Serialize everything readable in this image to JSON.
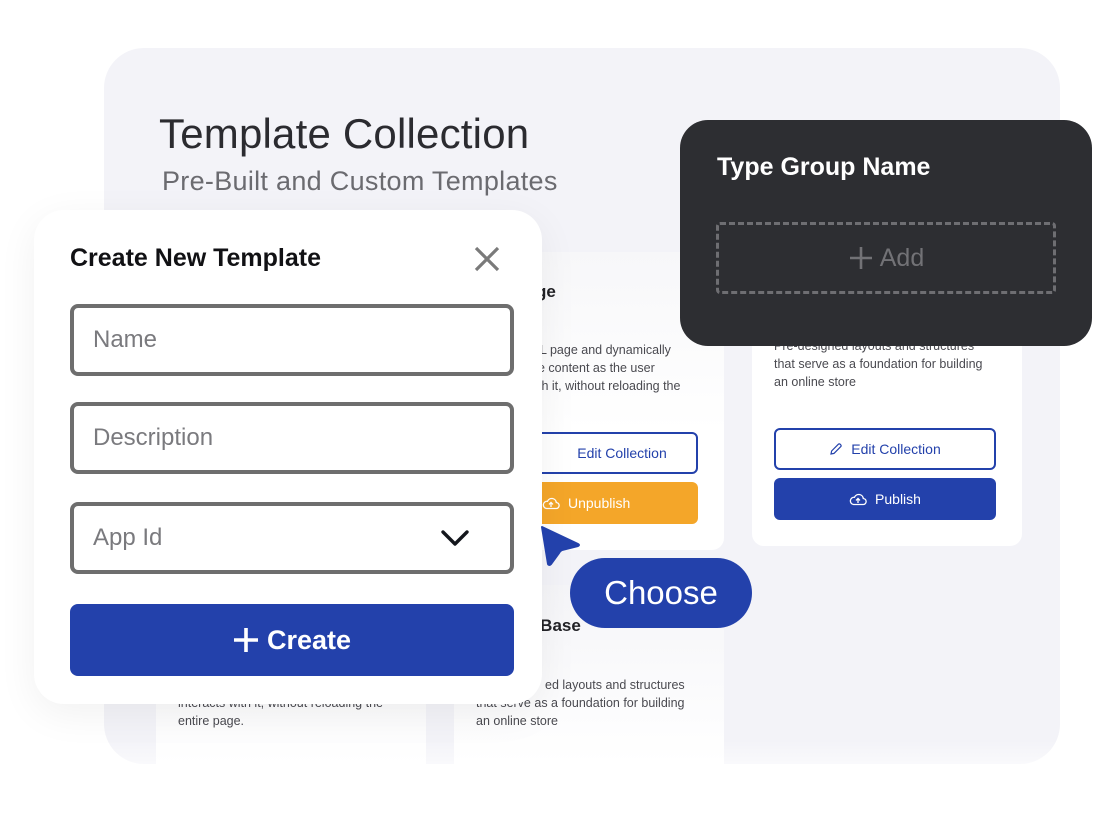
{
  "header": {
    "title": "Template Collection",
    "subtitle": "Pre-Built and Custom Templates"
  },
  "cards": [
    {
      "title_visible": "ge",
      "desc_visible": [
        "L page and dynamically",
        "e content as the user",
        "th it, without reloading the",
        "."
      ],
      "edit_label": "Edit Collection",
      "action_label": "Unpublish",
      "action_color": "#f4a629"
    },
    {
      "desc_visible": [
        "Pre-designed layouts and structures",
        "that serve as a foundation for building",
        "an online store"
      ],
      "edit_label": "Edit Collection",
      "action_label": "Publish",
      "action_color": "#2341ab"
    },
    {
      "desc_visible": [
        "interacts with it, without reloading the",
        "entire page."
      ]
    },
    {
      "title_visible": "e Base",
      "desc_visible": [
        "ed layouts and structures",
        "that serve as a foundation for building",
        "an online store"
      ]
    }
  ],
  "group_panel": {
    "title": "Type Group Name",
    "add_label": "Add"
  },
  "modal": {
    "title": "Create New Template",
    "name_placeholder": "Name",
    "description_placeholder": "Description",
    "app_id_placeholder": "App Id",
    "create_label": "Create"
  },
  "choose_label": "Choose",
  "colors": {
    "primary": "#2341ab",
    "warning": "#f4a629",
    "dark_panel": "#2d2e32",
    "background_panel": "#f3f3f8"
  }
}
